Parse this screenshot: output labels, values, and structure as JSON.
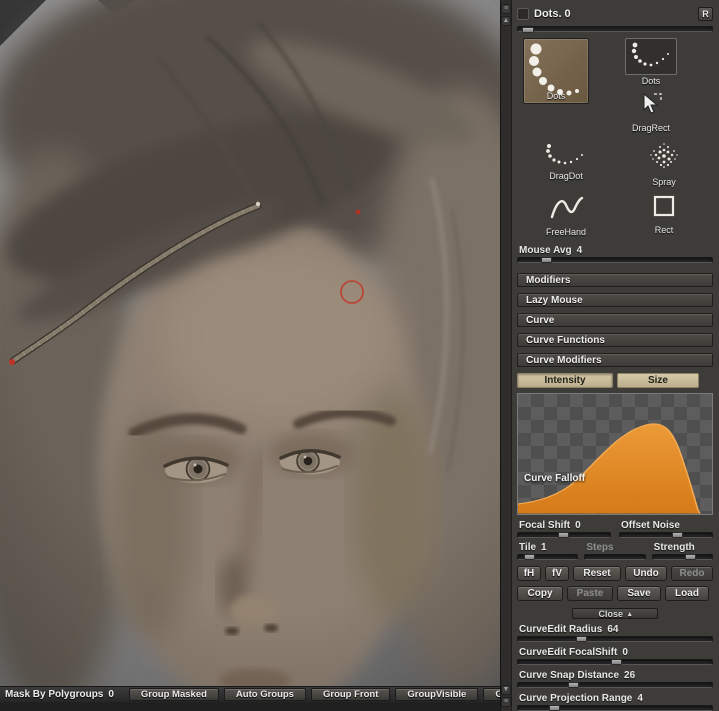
{
  "colors": {
    "curve_orange": "#e2862c",
    "tab_tan": "#cabd9c",
    "panel_bg": "#3d3c39",
    "selected_thumb": "#77654e",
    "cursor_red": "#c0392b"
  },
  "icons": {
    "r_badge": "R",
    "close_arrow": "▴",
    "scroll_up": "▲",
    "scroll_down": "▼",
    "menu_grip": "≡"
  },
  "viewport": {
    "bottom_bar": {
      "mask_label": "Mask By Polygroups",
      "mask_value": "0",
      "buttons": [
        "Group Masked",
        "Auto Groups",
        "Group Front",
        "GroupVisible",
        "Gro"
      ]
    }
  },
  "stroke_panel": {
    "title": "Dots. 0",
    "thumbnails": {
      "big_dots": "Dots",
      "dots": "Dots",
      "dragrect": "DragRect",
      "dragdot": "DragDot",
      "spray": "Spray",
      "freehand": "FreeHand",
      "rect": "Rect"
    },
    "mouse_avg_label": "Mouse Avg",
    "mouse_avg_value": "4",
    "sections": [
      {
        "label": "Modifiers"
      },
      {
        "label": "Lazy Mouse"
      },
      {
        "label": "Curve"
      },
      {
        "label": "Curve Functions"
      },
      {
        "label": "Curve Modifiers"
      }
    ],
    "tabs": [
      {
        "label": "Intensity"
      },
      {
        "label": "Size"
      }
    ],
    "curve_falloff_label": "Curve Falloff",
    "sliders": {
      "focal_shift": {
        "label": "Focal Shift",
        "value": "0"
      },
      "offset_noise": {
        "label": "Offset Noise",
        "value": ""
      },
      "tile": {
        "label": "Tile",
        "value": "1"
      },
      "steps": {
        "label": "Steps",
        "value": ""
      },
      "strength": {
        "label": "Strength",
        "value": ""
      }
    },
    "buttons": {
      "fh": "fH",
      "fv": "fV",
      "reset": "Reset",
      "undo": "Undo",
      "redo": "Redo",
      "copy": "Copy",
      "paste": "Paste",
      "save": "Save",
      "load": "Load",
      "close": "Close"
    },
    "bottom_sliders": [
      {
        "label": "CurveEdit Radius",
        "value": "64"
      },
      {
        "label": "CurveEdit FocalShift",
        "value": "0"
      },
      {
        "label": "Curve Snap Distance",
        "value": "26"
      },
      {
        "label": "Curve Projection Range",
        "value": "4"
      }
    ]
  }
}
